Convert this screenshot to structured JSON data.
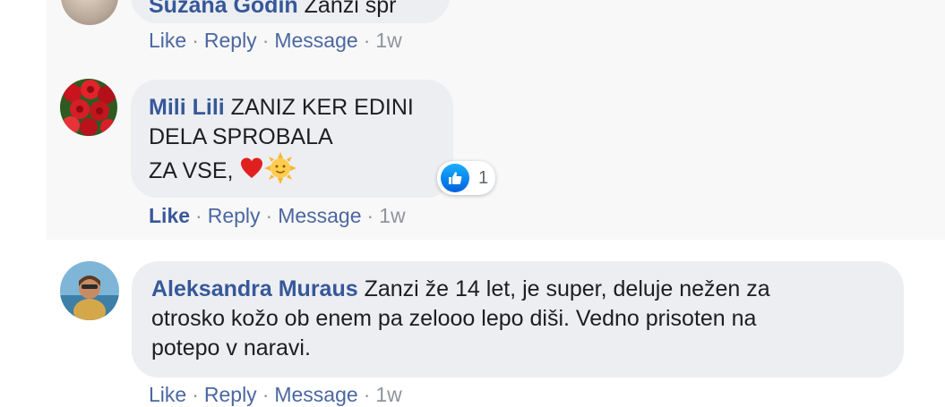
{
  "comments": [
    {
      "author": "Suzana Godin",
      "text": "Zanzi spr",
      "actions": {
        "like": "Like",
        "reply": "Reply",
        "message": "Message",
        "time": "1w"
      }
    },
    {
      "author": "Mili Lili",
      "text_line1": "ZANIZ KER EDINI",
      "text_line2": "DELA SPROBALA",
      "text_line3": "ZA VSE,",
      "emojis": [
        "red-heart",
        "sun-with-face"
      ],
      "reaction_count": "1",
      "actions": {
        "like": "Like",
        "reply": "Reply",
        "message": "Message",
        "time": "1w"
      }
    },
    {
      "author": "Aleksandra Muraus",
      "text_line1": "Zanzi že 14 let, je super, deluje nežen za",
      "text_line2": "otrosko kožo ob enem pa zelooo lepo diši. Vedno prisoten na",
      "text_line3": "potepo v naravi.",
      "actions": {
        "like": "Like",
        "reply": "Reply",
        "message": "Message",
        "time": "1w"
      }
    }
  ],
  "separator": "·",
  "colors": {
    "author": "#365899",
    "link": "#4b67a1",
    "bubble": "#eceef2",
    "like_blue": "#1877f2"
  }
}
